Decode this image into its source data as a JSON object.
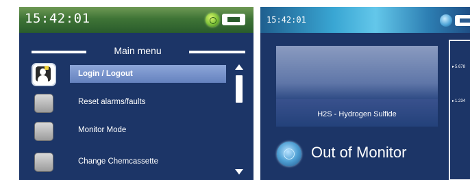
{
  "left_screen": {
    "clock": "15:42:01",
    "menu_title": "Main menu",
    "menu_items": [
      {
        "label": "Login / Logout",
        "icon": "user-lock-icon",
        "selected": true
      },
      {
        "label": "Reset alarms/faults",
        "icon": "button-icon",
        "selected": false
      },
      {
        "label": "Monitor Mode",
        "icon": "button-icon",
        "selected": false
      },
      {
        "label": "Change Chemcassette",
        "icon": "button-icon",
        "selected": false
      }
    ]
  },
  "right_screen": {
    "clock": "15:42:01",
    "gas_name": "H2S - Hydrogen Sulfide",
    "trend_ticks": [
      "5.678",
      "1.234"
    ],
    "monitor_status": "Out of Monitor"
  },
  "colors": {
    "screen_bg": "#1c3567",
    "left_statusbar": "#3f7436",
    "right_statusbar": "#39a6d3",
    "selected_item": "#7891c9"
  }
}
